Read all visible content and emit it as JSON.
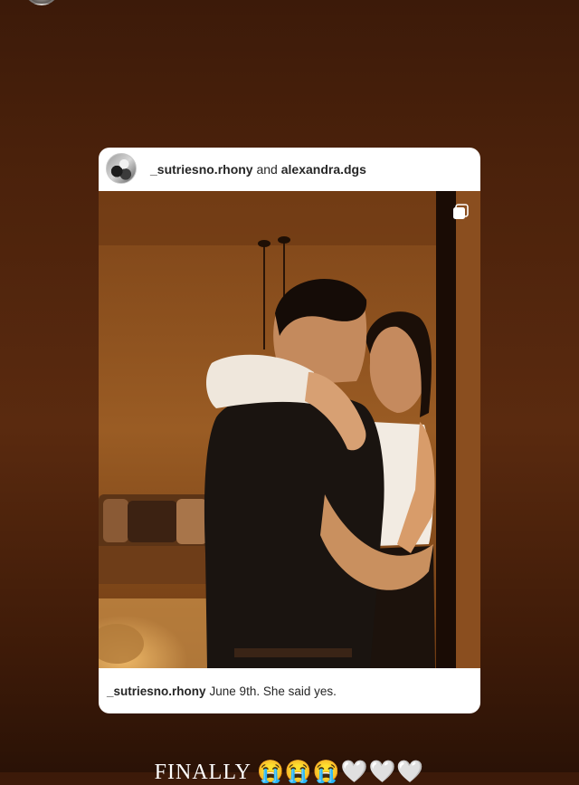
{
  "post": {
    "author": "_sutriesno.rhony",
    "conjunction": "and",
    "collaborator": "alexandra.dgs",
    "caption_user": "_sutriesno.rhony",
    "caption_text": "June 9th. She said yes."
  },
  "story": {
    "overlay_text": "FINALLY 😭😭😭🤍🤍🤍"
  },
  "icons": {
    "top_avatar": "profile-avatar",
    "post_avatar": "profile-avatar",
    "multi_post": "multiple-images-icon"
  }
}
